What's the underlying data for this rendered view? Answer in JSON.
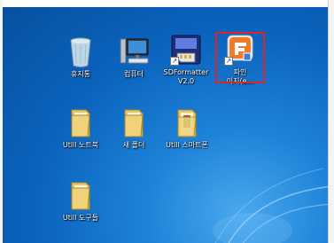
{
  "desktop": {
    "icons": [
      {
        "label": "휴지통",
        "icon": "recycle-bin-icon"
      },
      {
        "label": "컴퓨터",
        "icon": "computer-icon"
      },
      {
        "label": "SDFormatter V2.0",
        "line1": "SDFormatter",
        "line2": "V2.0",
        "icon": "sdformatter-icon"
      },
      {
        "label": "파인 이지(e...",
        "line1": "파인",
        "line2": "이지(e...",
        "icon": "finedrive-icon",
        "selected": true
      },
      {
        "label": "Utill 노트북",
        "icon": "folder-icon"
      },
      {
        "label": "새 폴더",
        "icon": "folder-icon"
      },
      {
        "label": "Utill 스마트폰",
        "icon": "folder-icon"
      },
      {
        "label": "Utill 도구들",
        "icon": "folder-icon"
      }
    ],
    "highlight_color": "#d8262b"
  }
}
